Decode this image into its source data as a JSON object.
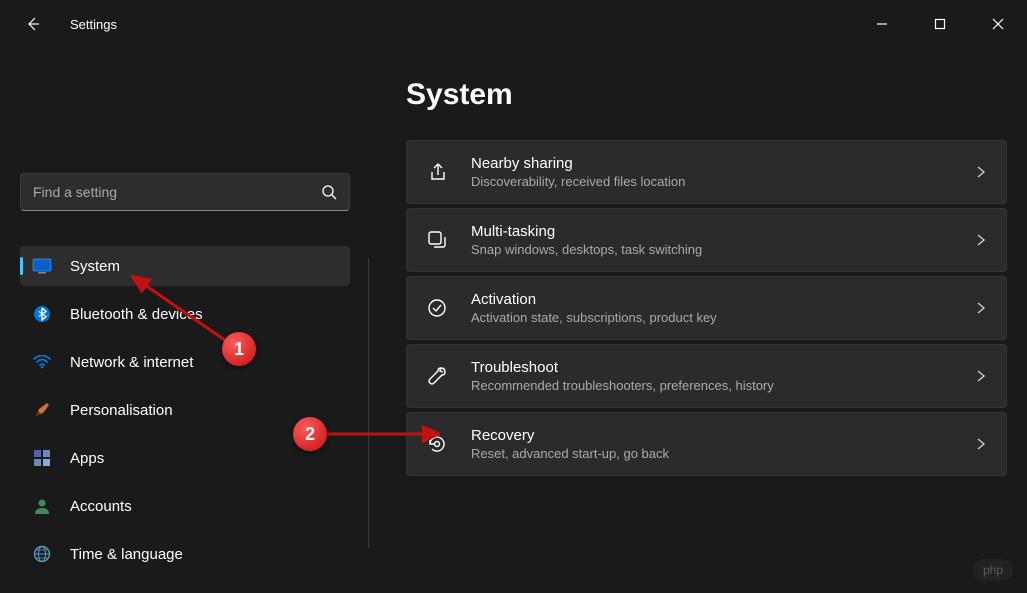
{
  "window": {
    "title": "Settings"
  },
  "sidebar": {
    "search_placeholder": "Find a setting",
    "items": [
      {
        "label": "System",
        "icon": "system",
        "active": true
      },
      {
        "label": "Bluetooth & devices",
        "icon": "bluetooth",
        "active": false
      },
      {
        "label": "Network & internet",
        "icon": "network",
        "active": false
      },
      {
        "label": "Personalisation",
        "icon": "personalisation",
        "active": false
      },
      {
        "label": "Apps",
        "icon": "apps",
        "active": false
      },
      {
        "label": "Accounts",
        "icon": "accounts",
        "active": false
      },
      {
        "label": "Time & language",
        "icon": "time-language",
        "active": false
      }
    ]
  },
  "main": {
    "heading": "System",
    "cards": [
      {
        "title": "Nearby sharing",
        "subtitle": "Discoverability, received files location",
        "icon": "share"
      },
      {
        "title": "Multi-tasking",
        "subtitle": "Snap windows, desktops, task switching",
        "icon": "multitask"
      },
      {
        "title": "Activation",
        "subtitle": "Activation state, subscriptions, product key",
        "icon": "activation"
      },
      {
        "title": "Troubleshoot",
        "subtitle": "Recommended troubleshooters, preferences, history",
        "icon": "troubleshoot"
      },
      {
        "title": "Recovery",
        "subtitle": "Reset, advanced start-up, go back",
        "icon": "recovery"
      }
    ]
  },
  "annotations": {
    "badge1": "1",
    "badge2": "2"
  },
  "watermark": "php"
}
